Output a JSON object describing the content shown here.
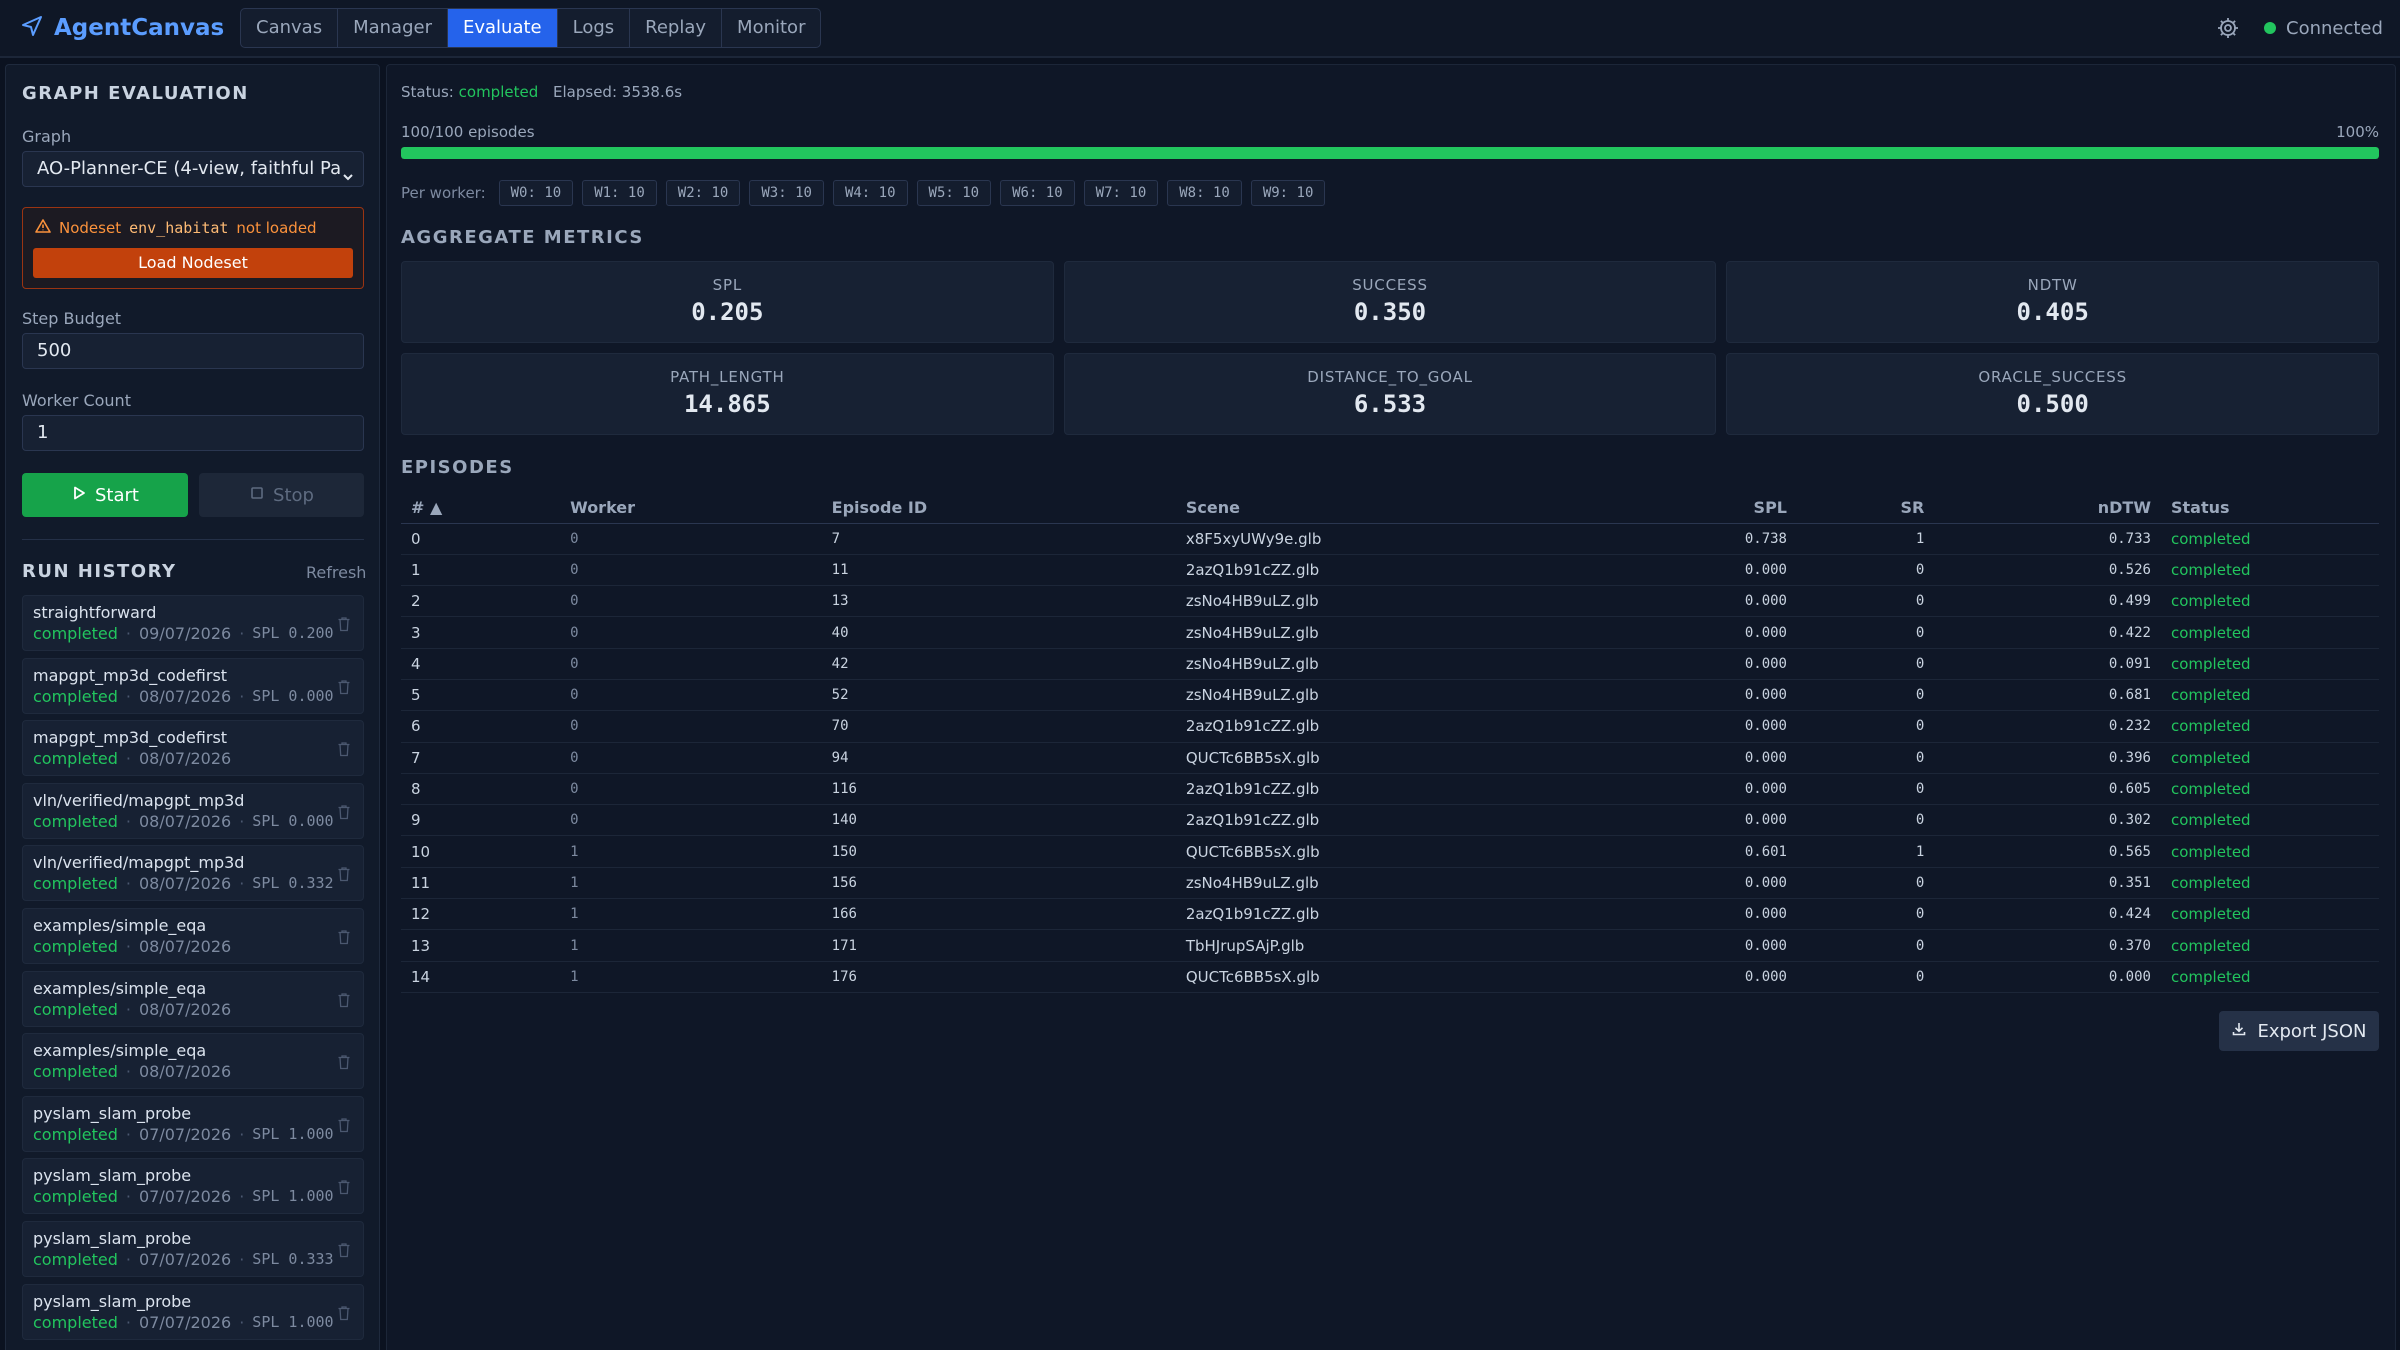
{
  "app": {
    "name": "AgentCanvas"
  },
  "nav": {
    "tabs": [
      "Canvas",
      "Manager",
      "Evaluate",
      "Logs",
      "Replay",
      "Monitor"
    ],
    "active": "Evaluate"
  },
  "connection": {
    "label": "Connected",
    "color": "#22c55e"
  },
  "sidebar": {
    "title": "GRAPH EVALUATION",
    "graph_label": "Graph",
    "graph_value": "AO-Planner-CE (4-view, faithful Pa",
    "warning": {
      "prefix": "Nodeset",
      "code": "env_habitat",
      "suffix": "not loaded",
      "button": "Load Nodeset"
    },
    "step_budget_label": "Step Budget",
    "step_budget_value": "500",
    "worker_count_label": "Worker Count",
    "worker_count_value": "1",
    "start_label": "Start",
    "stop_label": "Stop",
    "run_history_title": "RUN HISTORY",
    "refresh_label": "Refresh",
    "runs": [
      {
        "name": "straightforward",
        "status": "completed",
        "date": "09/07/2026",
        "spl": "SPL 0.200"
      },
      {
        "name": "mapgpt_mp3d_codefirst",
        "status": "completed",
        "date": "08/07/2026",
        "spl": "SPL 0.000"
      },
      {
        "name": "mapgpt_mp3d_codefirst",
        "status": "completed",
        "date": "08/07/2026",
        "spl": ""
      },
      {
        "name": "vln/verified/mapgpt_mp3d",
        "status": "completed",
        "date": "08/07/2026",
        "spl": "SPL 0.000"
      },
      {
        "name": "vln/verified/mapgpt_mp3d",
        "status": "completed",
        "date": "08/07/2026",
        "spl": "SPL 0.332"
      },
      {
        "name": "examples/simple_eqa",
        "status": "completed",
        "date": "08/07/2026",
        "spl": ""
      },
      {
        "name": "examples/simple_eqa",
        "status": "completed",
        "date": "08/07/2026",
        "spl": ""
      },
      {
        "name": "examples/simple_eqa",
        "status": "completed",
        "date": "08/07/2026",
        "spl": ""
      },
      {
        "name": "pyslam_slam_probe",
        "status": "completed",
        "date": "07/07/2026",
        "spl": "SPL 1.000"
      },
      {
        "name": "pyslam_slam_probe",
        "status": "completed",
        "date": "07/07/2026",
        "spl": "SPL 1.000"
      },
      {
        "name": "pyslam_slam_probe",
        "status": "completed",
        "date": "07/07/2026",
        "spl": "SPL 0.333"
      },
      {
        "name": "pyslam_slam_probe",
        "status": "completed",
        "date": "07/07/2026",
        "spl": "SPL 1.000"
      }
    ]
  },
  "main": {
    "status_label": "Status:",
    "status_value": "completed",
    "elapsed_label": "Elapsed:",
    "elapsed_value": "3538.6s",
    "episodes_count": "100/100 episodes",
    "progress_percent": "100%",
    "progress_fraction": 1.0,
    "per_worker_label": "Per worker:",
    "per_worker": [
      "W0: 10",
      "W1: 10",
      "W2: 10",
      "W3: 10",
      "W4: 10",
      "W5: 10",
      "W6: 10",
      "W7: 10",
      "W8: 10",
      "W9: 10"
    ],
    "aggregate_title": "AGGREGATE METRICS",
    "metrics": [
      {
        "label": "SPL",
        "value": "0.205"
      },
      {
        "label": "SUCCESS",
        "value": "0.350"
      },
      {
        "label": "NDTW",
        "value": "0.405"
      },
      {
        "label": "PATH_LENGTH",
        "value": "14.865"
      },
      {
        "label": "DISTANCE_TO_GOAL",
        "value": "6.533"
      },
      {
        "label": "ORACLE_SUCCESS",
        "value": "0.500"
      }
    ],
    "episodes_title": "EPISODES",
    "columns": [
      "# ▲",
      "Worker",
      "Episode ID",
      "Scene",
      "SPL",
      "SR",
      "nDTW",
      "Status"
    ],
    "rows": [
      [
        "0",
        "0",
        "7",
        "x8F5xyUWy9e.glb",
        "0.738",
        "1",
        "0.733",
        "completed"
      ],
      [
        "1",
        "0",
        "11",
        "2azQ1b91cZZ.glb",
        "0.000",
        "0",
        "0.526",
        "completed"
      ],
      [
        "2",
        "0",
        "13",
        "zsNo4HB9uLZ.glb",
        "0.000",
        "0",
        "0.499",
        "completed"
      ],
      [
        "3",
        "0",
        "40",
        "zsNo4HB9uLZ.glb",
        "0.000",
        "0",
        "0.422",
        "completed"
      ],
      [
        "4",
        "0",
        "42",
        "zsNo4HB9uLZ.glb",
        "0.000",
        "0",
        "0.091",
        "completed"
      ],
      [
        "5",
        "0",
        "52",
        "zsNo4HB9uLZ.glb",
        "0.000",
        "0",
        "0.681",
        "completed"
      ],
      [
        "6",
        "0",
        "70",
        "2azQ1b91cZZ.glb",
        "0.000",
        "0",
        "0.232",
        "completed"
      ],
      [
        "7",
        "0",
        "94",
        "QUCTc6BB5sX.glb",
        "0.000",
        "0",
        "0.396",
        "completed"
      ],
      [
        "8",
        "0",
        "116",
        "2azQ1b91cZZ.glb",
        "0.000",
        "0",
        "0.605",
        "completed"
      ],
      [
        "9",
        "0",
        "140",
        "2azQ1b91cZZ.glb",
        "0.000",
        "0",
        "0.302",
        "completed"
      ],
      [
        "10",
        "1",
        "150",
        "QUCTc6BB5sX.glb",
        "0.601",
        "1",
        "0.565",
        "completed"
      ],
      [
        "11",
        "1",
        "156",
        "zsNo4HB9uLZ.glb",
        "0.000",
        "0",
        "0.351",
        "completed"
      ],
      [
        "12",
        "1",
        "166",
        "2azQ1b91cZZ.glb",
        "0.000",
        "0",
        "0.424",
        "completed"
      ],
      [
        "13",
        "1",
        "171",
        "TbHJrupSAjP.glb",
        "0.000",
        "0",
        "0.370",
        "completed"
      ],
      [
        "14",
        "1",
        "176",
        "QUCTc6BB5sX.glb",
        "0.000",
        "0",
        "0.000",
        "completed"
      ]
    ],
    "export_label": "Export JSON"
  }
}
